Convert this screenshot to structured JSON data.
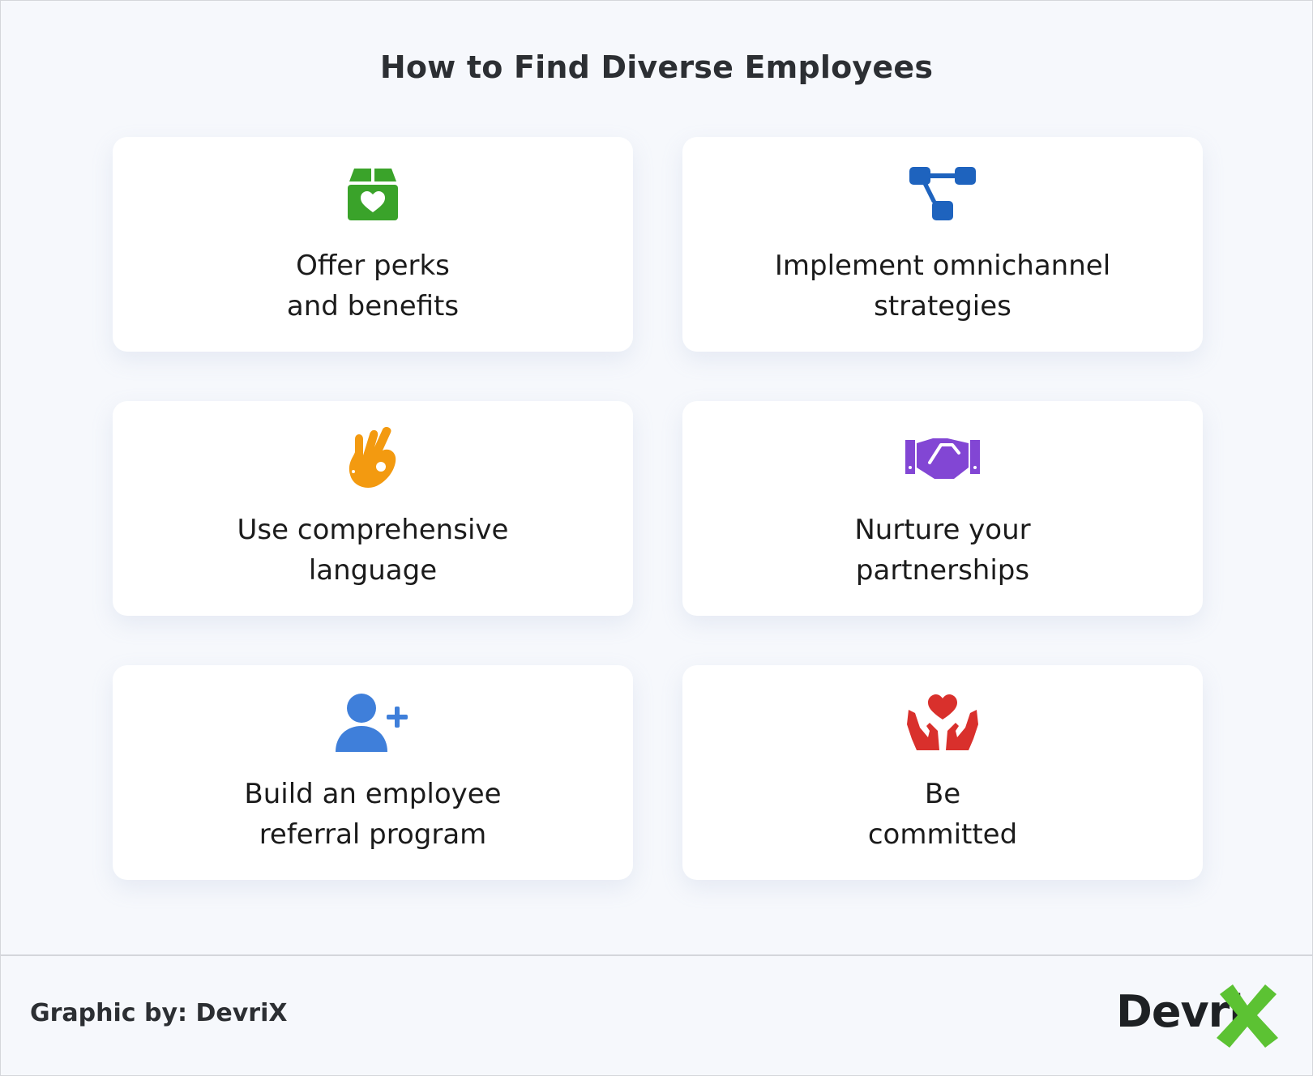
{
  "title": "How to Find Diverse Employees",
  "cards": [
    {
      "lines": [
        "Offer perks",
        "and benefits"
      ],
      "icon": "gift-box-heart-icon",
      "color": "#3aa32a"
    },
    {
      "lines": [
        "Implement omnichannel",
        "strategies"
      ],
      "icon": "channel-nodes-icon",
      "color": "#1e63be"
    },
    {
      "lines": [
        "Use comprehensive",
        "language"
      ],
      "icon": "ok-hand-icon",
      "color": "#f39a10"
    },
    {
      "lines": [
        "Nurture your",
        "partnerships"
      ],
      "icon": "handshake-icon",
      "color": "#8246d4"
    },
    {
      "lines": [
        "Build an employee",
        "referral program"
      ],
      "icon": "add-user-icon",
      "color": "#3f7fda"
    },
    {
      "lines": [
        "Be",
        "committed"
      ],
      "icon": "hands-heart-icon",
      "color": "#d9302c"
    }
  ],
  "footer": {
    "credit": "Graphic by: DevriX",
    "logo": {
      "text": "Devri",
      "x_color": "#5cc233"
    }
  }
}
